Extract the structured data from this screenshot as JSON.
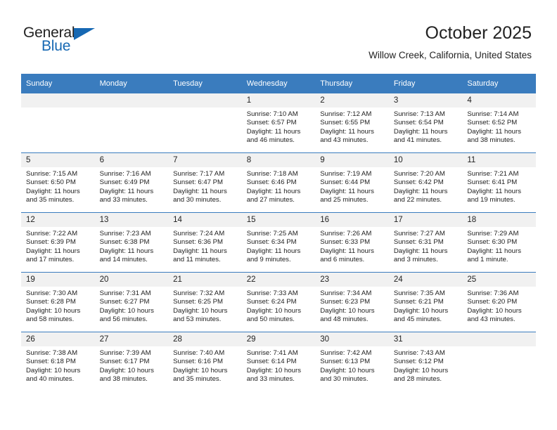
{
  "brand": {
    "name_top": "General",
    "name_bottom": "Blue",
    "accent_color": "#1668b3"
  },
  "header": {
    "title": "October 2025",
    "subtitle": "Willow Creek, California, United States"
  },
  "theme": {
    "header_row_bg": "#3a7cbe",
    "daynum_bg": "#f1f1f1",
    "text_color": "#222222",
    "page_bg": "#ffffff"
  },
  "weekdays": [
    "Sunday",
    "Monday",
    "Tuesday",
    "Wednesday",
    "Thursday",
    "Friday",
    "Saturday"
  ],
  "labels": {
    "sunrise": "Sunrise:",
    "sunset": "Sunset:",
    "daylight": "Daylight:"
  },
  "weeks": [
    [
      {
        "day": "",
        "empty": true
      },
      {
        "day": "",
        "empty": true
      },
      {
        "day": "",
        "empty": true
      },
      {
        "day": "1",
        "sunrise": "Sunrise: 7:10 AM",
        "sunset": "Sunset: 6:57 PM",
        "daylight": "Daylight: 11 hours and 46 minutes."
      },
      {
        "day": "2",
        "sunrise": "Sunrise: 7:12 AM",
        "sunset": "Sunset: 6:55 PM",
        "daylight": "Daylight: 11 hours and 43 minutes."
      },
      {
        "day": "3",
        "sunrise": "Sunrise: 7:13 AM",
        "sunset": "Sunset: 6:54 PM",
        "daylight": "Daylight: 11 hours and 41 minutes."
      },
      {
        "day": "4",
        "sunrise": "Sunrise: 7:14 AM",
        "sunset": "Sunset: 6:52 PM",
        "daylight": "Daylight: 11 hours and 38 minutes."
      }
    ],
    [
      {
        "day": "5",
        "sunrise": "Sunrise: 7:15 AM",
        "sunset": "Sunset: 6:50 PM",
        "daylight": "Daylight: 11 hours and 35 minutes."
      },
      {
        "day": "6",
        "sunrise": "Sunrise: 7:16 AM",
        "sunset": "Sunset: 6:49 PM",
        "daylight": "Daylight: 11 hours and 33 minutes."
      },
      {
        "day": "7",
        "sunrise": "Sunrise: 7:17 AM",
        "sunset": "Sunset: 6:47 PM",
        "daylight": "Daylight: 11 hours and 30 minutes."
      },
      {
        "day": "8",
        "sunrise": "Sunrise: 7:18 AM",
        "sunset": "Sunset: 6:46 PM",
        "daylight": "Daylight: 11 hours and 27 minutes."
      },
      {
        "day": "9",
        "sunrise": "Sunrise: 7:19 AM",
        "sunset": "Sunset: 6:44 PM",
        "daylight": "Daylight: 11 hours and 25 minutes."
      },
      {
        "day": "10",
        "sunrise": "Sunrise: 7:20 AM",
        "sunset": "Sunset: 6:42 PM",
        "daylight": "Daylight: 11 hours and 22 minutes."
      },
      {
        "day": "11",
        "sunrise": "Sunrise: 7:21 AM",
        "sunset": "Sunset: 6:41 PM",
        "daylight": "Daylight: 11 hours and 19 minutes."
      }
    ],
    [
      {
        "day": "12",
        "sunrise": "Sunrise: 7:22 AM",
        "sunset": "Sunset: 6:39 PM",
        "daylight": "Daylight: 11 hours and 17 minutes."
      },
      {
        "day": "13",
        "sunrise": "Sunrise: 7:23 AM",
        "sunset": "Sunset: 6:38 PM",
        "daylight": "Daylight: 11 hours and 14 minutes."
      },
      {
        "day": "14",
        "sunrise": "Sunrise: 7:24 AM",
        "sunset": "Sunset: 6:36 PM",
        "daylight": "Daylight: 11 hours and 11 minutes."
      },
      {
        "day": "15",
        "sunrise": "Sunrise: 7:25 AM",
        "sunset": "Sunset: 6:34 PM",
        "daylight": "Daylight: 11 hours and 9 minutes."
      },
      {
        "day": "16",
        "sunrise": "Sunrise: 7:26 AM",
        "sunset": "Sunset: 6:33 PM",
        "daylight": "Daylight: 11 hours and 6 minutes."
      },
      {
        "day": "17",
        "sunrise": "Sunrise: 7:27 AM",
        "sunset": "Sunset: 6:31 PM",
        "daylight": "Daylight: 11 hours and 3 minutes."
      },
      {
        "day": "18",
        "sunrise": "Sunrise: 7:29 AM",
        "sunset": "Sunset: 6:30 PM",
        "daylight": "Daylight: 11 hours and 1 minute."
      }
    ],
    [
      {
        "day": "19",
        "sunrise": "Sunrise: 7:30 AM",
        "sunset": "Sunset: 6:28 PM",
        "daylight": "Daylight: 10 hours and 58 minutes."
      },
      {
        "day": "20",
        "sunrise": "Sunrise: 7:31 AM",
        "sunset": "Sunset: 6:27 PM",
        "daylight": "Daylight: 10 hours and 56 minutes."
      },
      {
        "day": "21",
        "sunrise": "Sunrise: 7:32 AM",
        "sunset": "Sunset: 6:25 PM",
        "daylight": "Daylight: 10 hours and 53 minutes."
      },
      {
        "day": "22",
        "sunrise": "Sunrise: 7:33 AM",
        "sunset": "Sunset: 6:24 PM",
        "daylight": "Daylight: 10 hours and 50 minutes."
      },
      {
        "day": "23",
        "sunrise": "Sunrise: 7:34 AM",
        "sunset": "Sunset: 6:23 PM",
        "daylight": "Daylight: 10 hours and 48 minutes."
      },
      {
        "day": "24",
        "sunrise": "Sunrise: 7:35 AM",
        "sunset": "Sunset: 6:21 PM",
        "daylight": "Daylight: 10 hours and 45 minutes."
      },
      {
        "day": "25",
        "sunrise": "Sunrise: 7:36 AM",
        "sunset": "Sunset: 6:20 PM",
        "daylight": "Daylight: 10 hours and 43 minutes."
      }
    ],
    [
      {
        "day": "26",
        "sunrise": "Sunrise: 7:38 AM",
        "sunset": "Sunset: 6:18 PM",
        "daylight": "Daylight: 10 hours and 40 minutes."
      },
      {
        "day": "27",
        "sunrise": "Sunrise: 7:39 AM",
        "sunset": "Sunset: 6:17 PM",
        "daylight": "Daylight: 10 hours and 38 minutes."
      },
      {
        "day": "28",
        "sunrise": "Sunrise: 7:40 AM",
        "sunset": "Sunset: 6:16 PM",
        "daylight": "Daylight: 10 hours and 35 minutes."
      },
      {
        "day": "29",
        "sunrise": "Sunrise: 7:41 AM",
        "sunset": "Sunset: 6:14 PM",
        "daylight": "Daylight: 10 hours and 33 minutes."
      },
      {
        "day": "30",
        "sunrise": "Sunrise: 7:42 AM",
        "sunset": "Sunset: 6:13 PM",
        "daylight": "Daylight: 10 hours and 30 minutes."
      },
      {
        "day": "31",
        "sunrise": "Sunrise: 7:43 AM",
        "sunset": "Sunset: 6:12 PM",
        "daylight": "Daylight: 10 hours and 28 minutes."
      },
      {
        "day": "",
        "empty": true
      }
    ]
  ]
}
